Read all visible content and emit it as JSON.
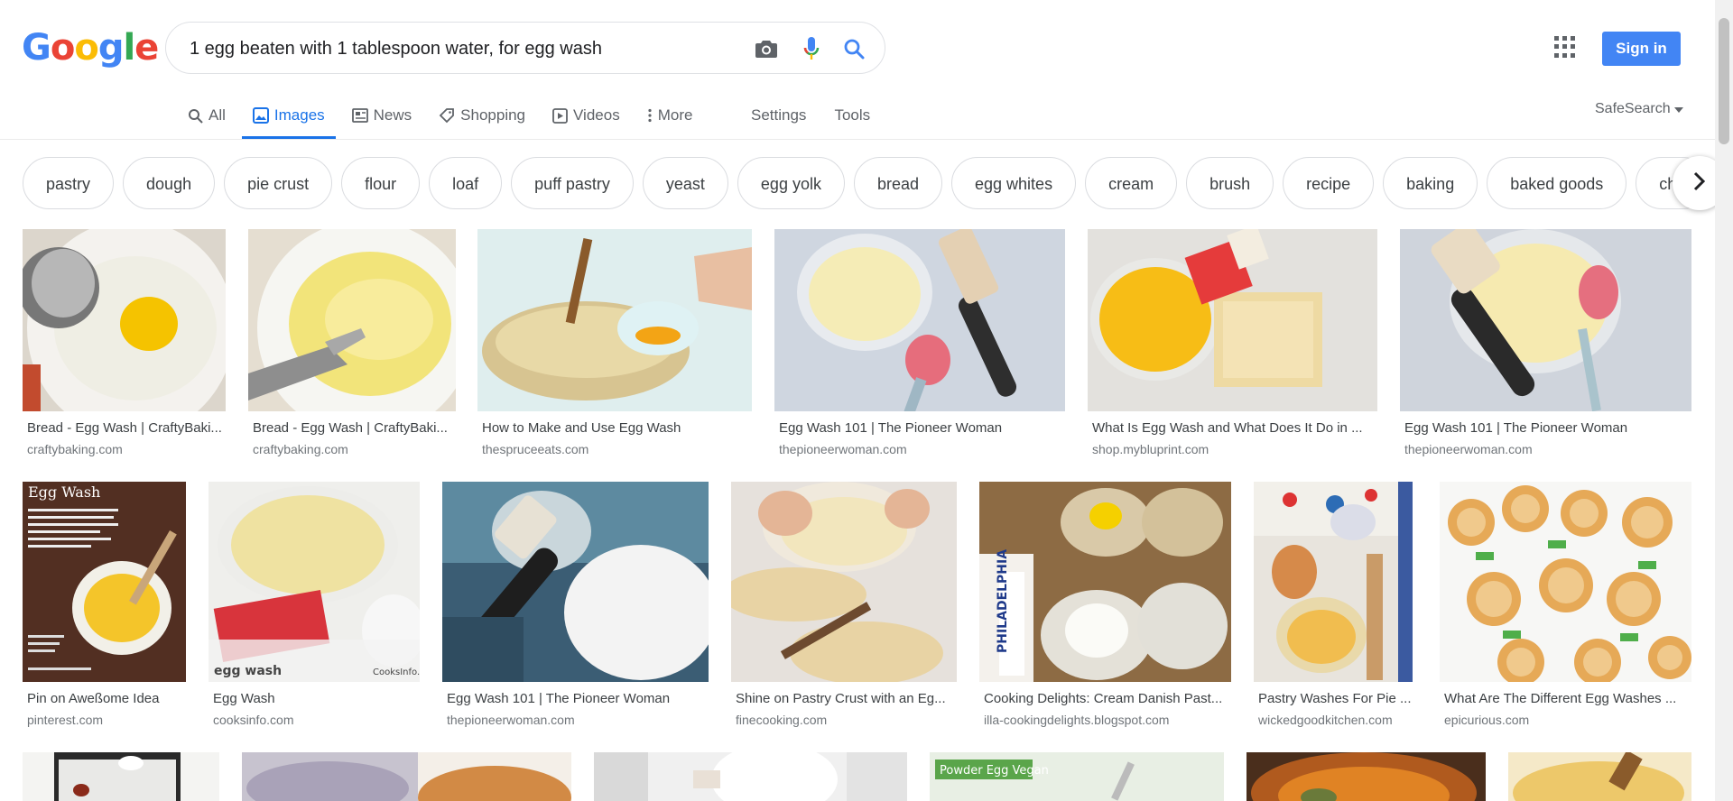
{
  "logo": {
    "letters": [
      "G",
      "o",
      "o",
      "g",
      "l",
      "e"
    ],
    "colors": [
      "#4285f4",
      "#ea4335",
      "#fbbc05",
      "#4285f4",
      "#34a853",
      "#ea4335"
    ]
  },
  "search": {
    "value": "1 egg beaten with 1 tablespoon water, for egg wash"
  },
  "header": {
    "sign_in": "Sign in"
  },
  "tabs": {
    "all": "All",
    "images": "Images",
    "news": "News",
    "shopping": "Shopping",
    "videos": "Videos",
    "more": "More",
    "settings": "Settings",
    "tools": "Tools",
    "safesearch": "SafeSearch"
  },
  "chips": [
    "pastry",
    "dough",
    "pie crust",
    "flour",
    "loaf",
    "puff pastry",
    "yeast",
    "egg yolk",
    "bread",
    "egg whites",
    "cream",
    "brush",
    "recipe",
    "baking",
    "baked goods",
    "cho"
  ],
  "colors": {
    "accent": "#1a73e8",
    "signin": "#4285f4"
  },
  "results": [
    {
      "title": "Bread - Egg Wash | CraftyBaki...",
      "source": "craftybaking.com"
    },
    {
      "title": "Bread - Egg Wash | CraftyBaki...",
      "source": "craftybaking.com"
    },
    {
      "title": "How to Make and Use Egg Wash",
      "source": "thespruceeats.com"
    },
    {
      "title": "Egg Wash 101 | The Pioneer Woman",
      "source": "thepioneerwoman.com"
    },
    {
      "title": "What Is Egg Wash and What Does It Do in ...",
      "source": "shop.mybluprint.com"
    },
    {
      "title": "Egg Wash 101 | The Pioneer Woman",
      "source": "thepioneerwoman.com"
    },
    {
      "title": "Pin on Aweßome Idea",
      "source": "pinterest.com"
    },
    {
      "title": "Egg Wash",
      "source": "cooksinfo.com"
    },
    {
      "title": "Egg Wash 101 | The Pioneer Woman",
      "source": "thepioneerwoman.com"
    },
    {
      "title": "Shine on Pastry Crust with an Eg...",
      "source": "finecooking.com"
    },
    {
      "title": "Cooking Delights: Cream Danish Past...",
      "source": "illa-cookingdelights.blogspot.com"
    },
    {
      "title": "Pastry Washes For Pie ...",
      "source": "wickedgoodkitchen.com"
    },
    {
      "title": "What Are The Different Egg Washes ...",
      "source": "epicurious.com"
    }
  ],
  "image_text": {
    "egg_wash_title": "Egg Wash",
    "cooksinfo_label": "egg wash",
    "cooksinfo_brand": "CooksInfo.",
    "philadelphia": "PHILADELPHIA",
    "powder_egg_vegan": "Powder Egg Vegan"
  }
}
